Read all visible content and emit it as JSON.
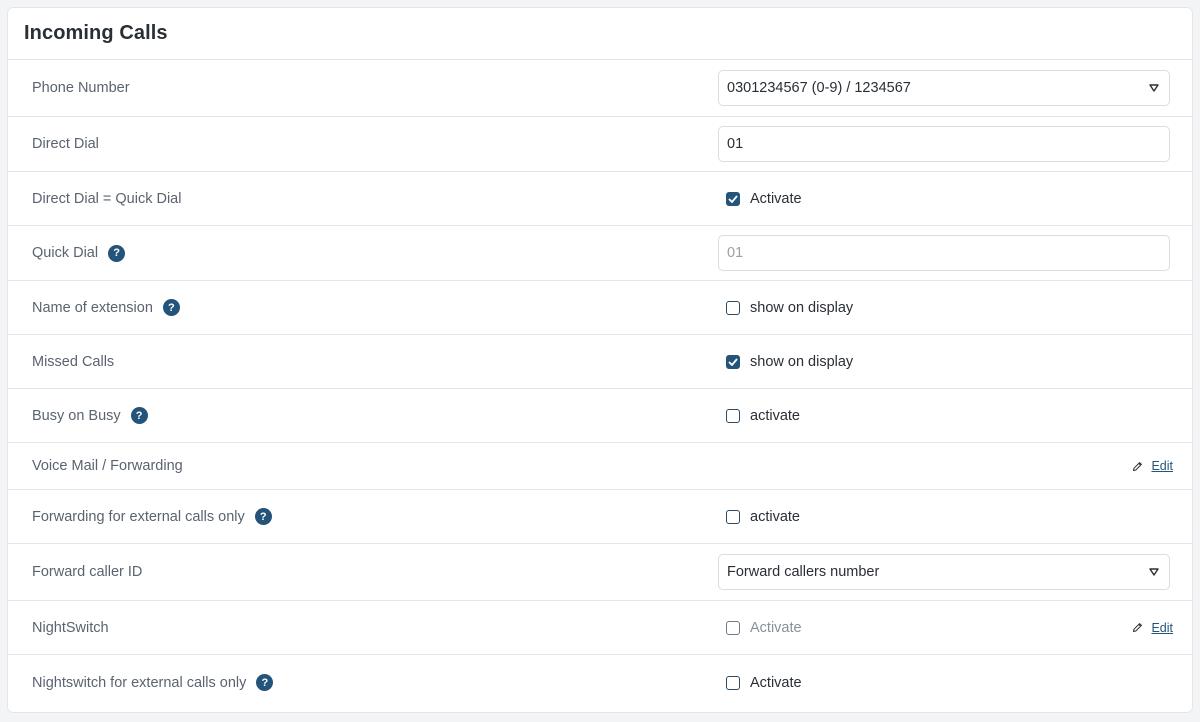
{
  "panel": {
    "title": "Incoming Calls"
  },
  "rows": {
    "phone_number": {
      "label": "Phone Number",
      "value": "0301234567 (0-9) / 1234567"
    },
    "direct_dial": {
      "label": "Direct Dial",
      "value": "01"
    },
    "direct_dial_quick": {
      "label": "Direct Dial = Quick Dial",
      "checkbox_label": "Activate",
      "checked": true
    },
    "quick_dial": {
      "label": "Quick Dial",
      "placeholder": "01"
    },
    "name_of_extension": {
      "label": "Name of extension",
      "checkbox_label": "show on display",
      "checked": false
    },
    "missed_calls": {
      "label": "Missed Calls",
      "checkbox_label": "show on display",
      "checked": true
    },
    "busy_on_busy": {
      "label": "Busy on Busy",
      "checkbox_label": "activate",
      "checked": false
    },
    "voicemail": {
      "label": "Voice Mail / Forwarding",
      "edit_label": "Edit"
    },
    "forwarding_external": {
      "label": "Forwarding for external calls only",
      "checkbox_label": "activate",
      "checked": false
    },
    "forward_caller_id": {
      "label": "Forward caller ID",
      "value": "Forward callers number"
    },
    "nightswitch": {
      "label": "NightSwitch",
      "checkbox_label": "Activate",
      "checked": false,
      "edit_label": "Edit"
    },
    "nightswitch_external": {
      "label": "Nightswitch for external calls only",
      "checkbox_label": "Activate",
      "checked": false
    }
  },
  "help_glyph": "?",
  "colors": {
    "accent": "#24547a",
    "label_text": "#5b6370",
    "border": "#e3e5e8"
  },
  "icons": {
    "select_arrow": "triangle-down-icon",
    "help": "question-circle-icon",
    "edit": "pencil-icon",
    "checkmark": "check-icon"
  }
}
